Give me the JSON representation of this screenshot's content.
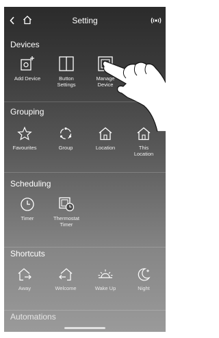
{
  "header": {
    "title": "Setting"
  },
  "icons": {
    "back": "chevron-left-icon",
    "home": "home-icon",
    "signal": "broadcast-icon"
  },
  "sections": {
    "devices": {
      "title": "Devices",
      "items": [
        "Add Device",
        "Button Settings",
        "Manage Device"
      ]
    },
    "grouping": {
      "title": "Grouping",
      "items": [
        "Favourites",
        "Group",
        "Location",
        "This Location"
      ]
    },
    "scheduling": {
      "title": "Scheduling",
      "items": [
        "Timer",
        "Thermostat Timer"
      ]
    },
    "shortcuts": {
      "title": "Shortcuts",
      "items": [
        "Away",
        "Welcome",
        "Wake Up",
        "Night"
      ]
    },
    "automations": {
      "title": "Automations"
    }
  },
  "colors": {
    "background_top": "#2b2b2b",
    "background_bottom": "#9a9a9a",
    "foreground": "#ffffff"
  }
}
